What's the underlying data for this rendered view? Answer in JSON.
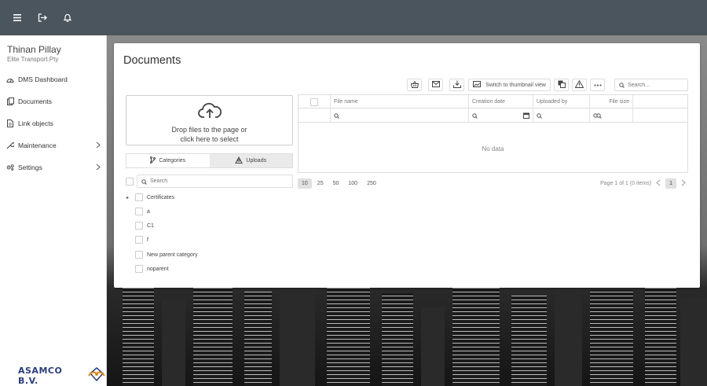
{
  "topbar": {
    "icons": [
      "menu-icon",
      "logout-icon",
      "bell-icon"
    ]
  },
  "user": {
    "name": "Thinan Pillay",
    "company": "Elite Transport Pty"
  },
  "sidebar": {
    "items": [
      {
        "label": "DMS Dashboard",
        "icon": "dashboard-icon",
        "has_children": false
      },
      {
        "label": "Documents",
        "icon": "documents-icon",
        "has_children": false
      },
      {
        "label": "Link objects",
        "icon": "link-objects-icon",
        "has_children": false
      },
      {
        "label": "Maintenance",
        "icon": "wrench-icon",
        "has_children": true
      },
      {
        "label": "Settings",
        "icon": "gear-icon",
        "has_children": true
      }
    ]
  },
  "logo": {
    "text": "ASAMCO B.V."
  },
  "main": {
    "title": "Documents",
    "toolbar": {
      "switch_view_label": "Switch to thumbnail view",
      "search_placeholder": "Search..."
    },
    "dropzone": {
      "line1": "Drop files to the page or",
      "line2": "click here to select"
    },
    "tabs": {
      "categories": "Categories",
      "uploads": "Uploads"
    },
    "category_search_placeholder": "Search",
    "categories": [
      {
        "label": "Certificates",
        "expandable": true
      },
      {
        "label": "a",
        "expandable": false
      },
      {
        "label": "C1",
        "expandable": false
      },
      {
        "label": "f",
        "expandable": false
      },
      {
        "label": "New parent category",
        "expandable": false
      },
      {
        "label": "noparent",
        "expandable": false
      }
    ],
    "grid": {
      "columns": {
        "file_name": "File name",
        "creation_date": "Creation date",
        "uploaded_by": "Uploaded by",
        "file_size": "File size"
      },
      "empty_text": "No data"
    },
    "pager": {
      "page_sizes": [
        "10",
        "25",
        "50",
        "100",
        "250"
      ],
      "selected_page_size": "10",
      "info": "Page 1 of 1 (0 items)",
      "current_page": "1"
    }
  }
}
